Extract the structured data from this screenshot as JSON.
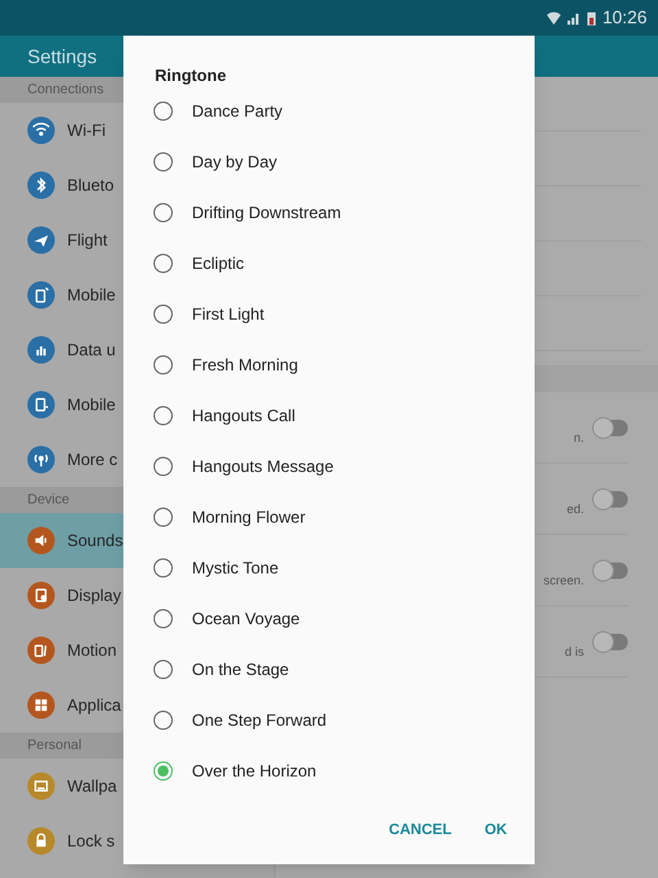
{
  "status_bar": {
    "time": "10:26"
  },
  "app_bar": {
    "title": "Settings"
  },
  "sidebar": {
    "sections": [
      {
        "header": "Connections",
        "items": [
          {
            "label": "Wi-Fi",
            "color": "#2a6fa6",
            "selected": false
          },
          {
            "label": "Blueto",
            "color": "#2a6fa6",
            "selected": false
          },
          {
            "label": "Flight",
            "color": "#2a6fa6",
            "selected": false
          },
          {
            "label": "Mobile",
            "color": "#2a6fa6",
            "selected": false
          },
          {
            "label": "Data u",
            "color": "#2a6fa6",
            "selected": false
          },
          {
            "label": "Mobile",
            "color": "#2a6fa6",
            "selected": false
          },
          {
            "label": "More c",
            "color": "#2a6fa6",
            "selected": false
          }
        ]
      },
      {
        "header": "Device",
        "items": [
          {
            "label": "Sounds",
            "color": "#b4571f",
            "selected": true
          },
          {
            "label": "Display",
            "color": "#b4571f",
            "selected": false
          },
          {
            "label": "Motion",
            "color": "#b4571f",
            "selected": false
          },
          {
            "label": "Applica",
            "color": "#b4571f",
            "selected": false
          }
        ]
      },
      {
        "header": "Personal",
        "items": [
          {
            "label": "Wallpa",
            "color": "#b8892a",
            "selected": false
          },
          {
            "label": "Lock s",
            "color": "#b8892a",
            "selected": false
          }
        ]
      }
    ]
  },
  "detail": {
    "toggle_rows": [
      {
        "text": "n.",
        "on": false
      },
      {
        "text": "ed.",
        "on": false
      },
      {
        "text": "screen.",
        "on": false
      },
      {
        "text": "d is",
        "on": false
      }
    ]
  },
  "dialog": {
    "title": "Ringtone",
    "options": [
      {
        "label": "Dance Party",
        "selected": false
      },
      {
        "label": "Day by Day",
        "selected": false
      },
      {
        "label": "Drifting Downstream",
        "selected": false
      },
      {
        "label": "Ecliptic",
        "selected": false
      },
      {
        "label": "First Light",
        "selected": false
      },
      {
        "label": "Fresh Morning",
        "selected": false
      },
      {
        "label": "Hangouts Call",
        "selected": false
      },
      {
        "label": "Hangouts Message",
        "selected": false
      },
      {
        "label": "Morning Flower",
        "selected": false
      },
      {
        "label": "Mystic Tone",
        "selected": false
      },
      {
        "label": "Ocean Voyage",
        "selected": false
      },
      {
        "label": "On the Stage",
        "selected": false
      },
      {
        "label": "One Step Forward",
        "selected": false
      },
      {
        "label": "Over the Horizon",
        "selected": true
      }
    ],
    "buttons": [
      "CANCEL",
      "OK"
    ]
  }
}
